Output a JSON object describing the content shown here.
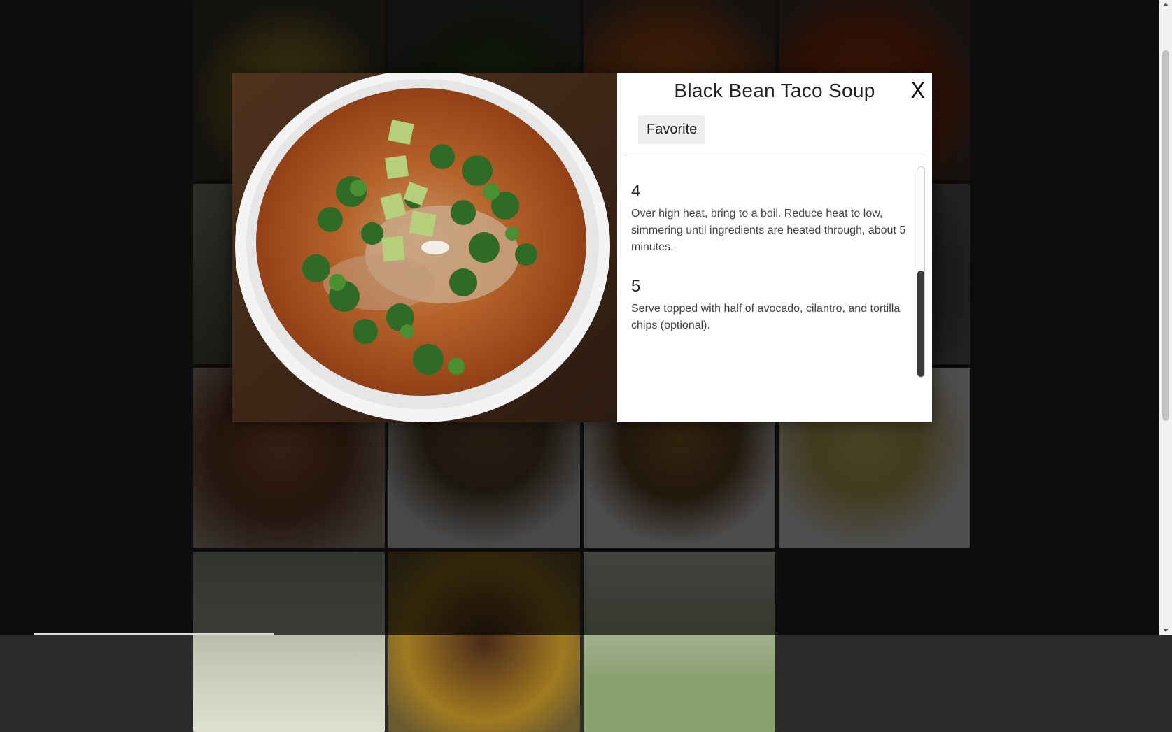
{
  "modal": {
    "title": "Black Bean Taco Soup",
    "close_label": "X",
    "favorite_label": "Favorite",
    "steps": [
      {
        "number": "4",
        "text": "Over high heat, bring to a boil. Reduce heat to low, simmering until ingredients are heated through, about 5 minutes."
      },
      {
        "number": "5",
        "text": "Serve topped with half of avocado, cilantro, and tortilla chips (optional)."
      }
    ]
  },
  "grid": {
    "tile_colors": [
      "#6b5a2a",
      "#3a4a2a",
      "#8a4a1a",
      "#9a3a1a",
      "#5a5a4a",
      "#2a2a2a",
      "#2a2a2a",
      "#4a4a4a",
      "#6a5040",
      "#7a6040",
      "#6a5030",
      "#bda850",
      "#5a5040",
      "#4a3020",
      "#c0b090",
      "#2b2b2b"
    ]
  }
}
